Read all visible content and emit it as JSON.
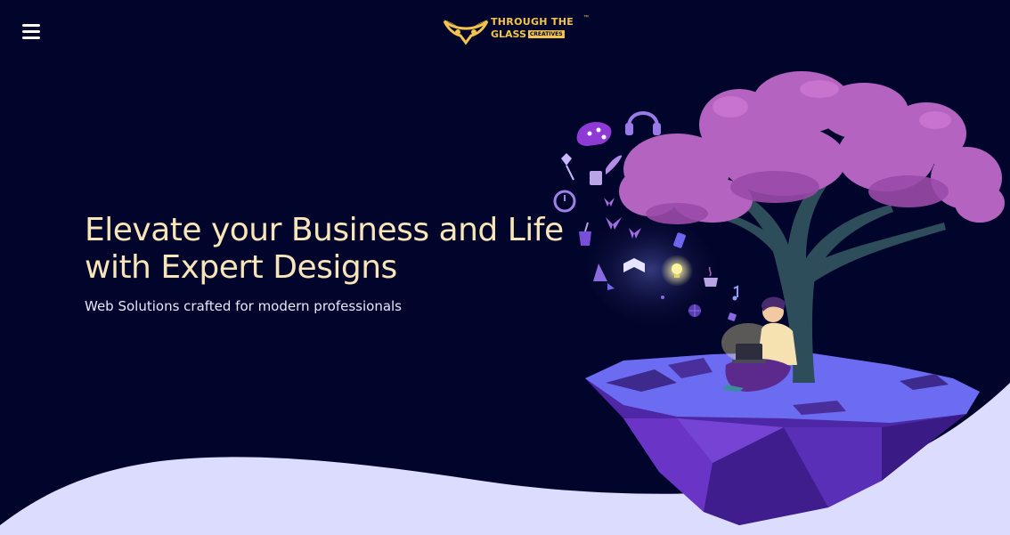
{
  "header": {
    "menu_icon": "hamburger-menu-icon",
    "logo": {
      "line1": "THROUGH THE",
      "line2": "GLASS",
      "badge": "CREATIVES",
      "tm": "™",
      "icon": "owl-mask-logo-icon"
    }
  },
  "hero": {
    "title_line1": "Elevate your Business and Life",
    "title_line2": "with Expert Designs",
    "subtitle": "Web Solutions crafted for modern professionals"
  },
  "colors": {
    "background": "#02052b",
    "title": "#f8e5b9",
    "logo": "#f2c44d",
    "wave": "#dcdcff",
    "island_top": "#6969f0",
    "island_body": "#5b2bb0",
    "tree_foliage": "#b563c0"
  },
  "illustration": {
    "name": "floating-island-tree-illustration",
    "icons": [
      "palette-icon",
      "headphones-icon",
      "flower-icon",
      "feather-quill-icon",
      "alarm-clock-icon",
      "butterfly-icon",
      "drink-cup-icon",
      "phone-icon",
      "book-icon",
      "lightbulb-icon",
      "coffee-cup-icon",
      "music-note-icon",
      "globe-icon"
    ]
  }
}
